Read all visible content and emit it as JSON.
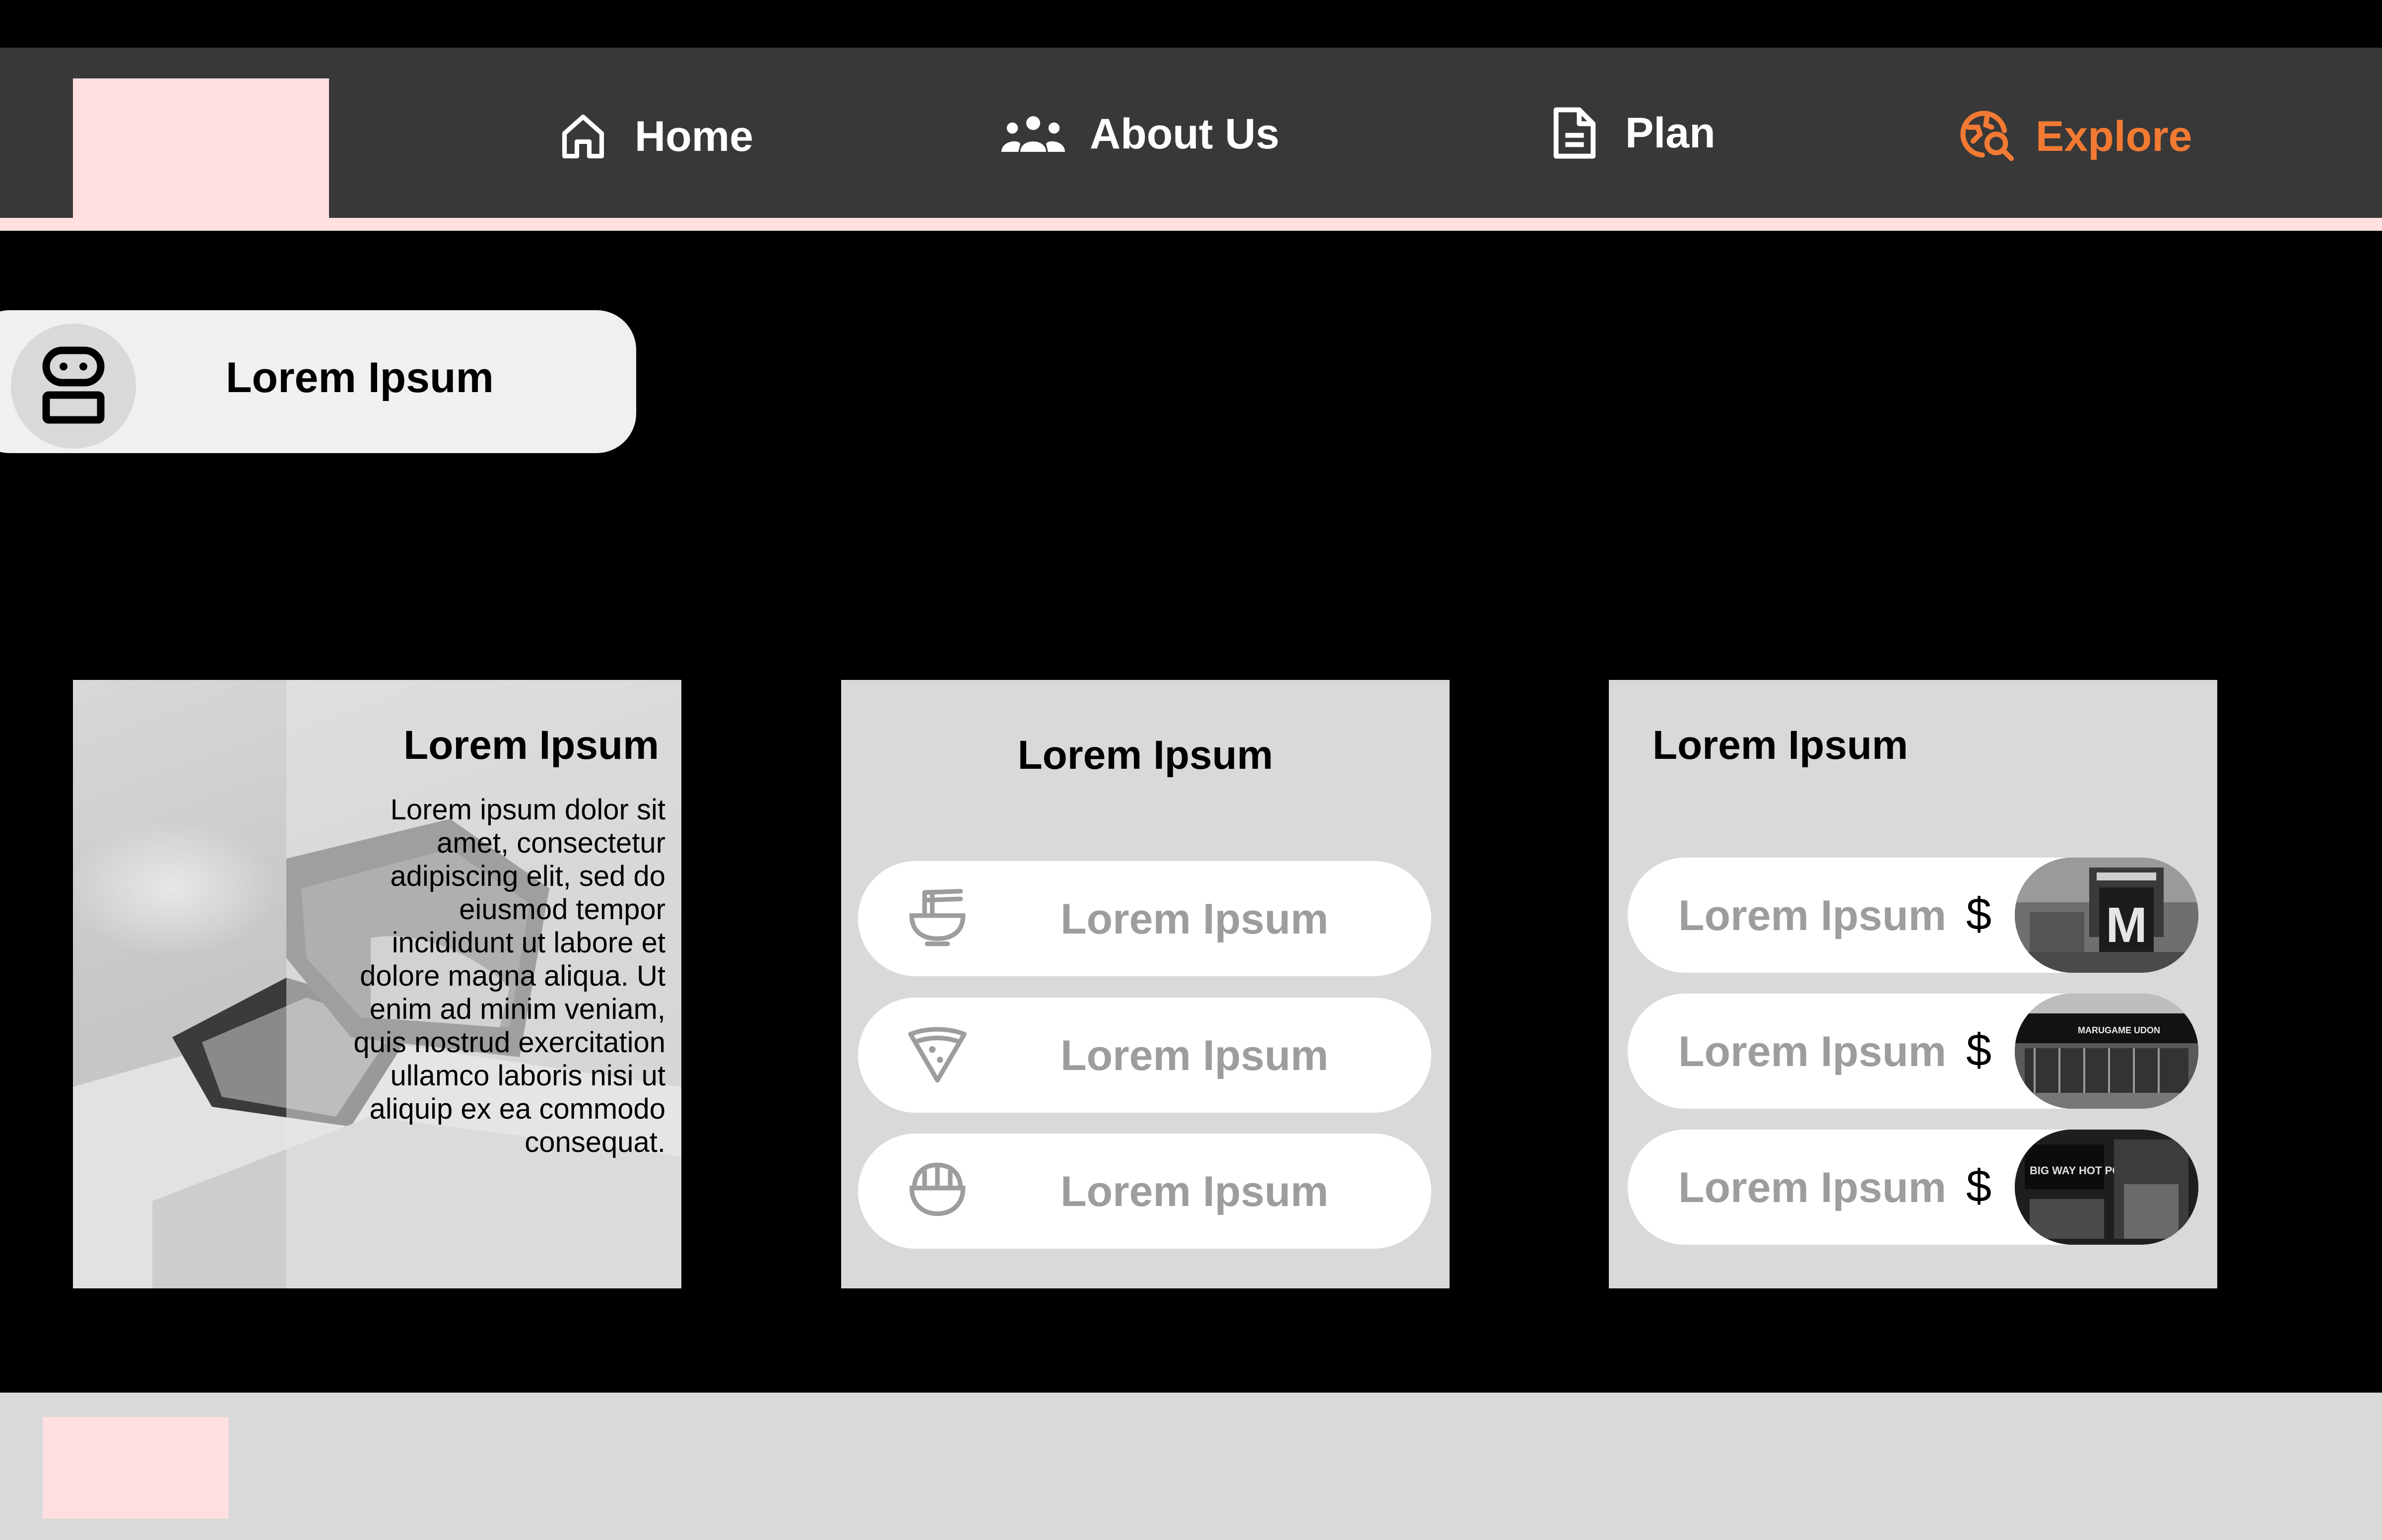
{
  "nav": {
    "items": [
      {
        "label": "Home",
        "icon": "home-icon"
      },
      {
        "label": "About Us",
        "icon": "users-icon"
      },
      {
        "label": "Plan",
        "icon": "document-icon"
      },
      {
        "label": "Explore",
        "icon": "explore-search-icon"
      }
    ],
    "active": "Explore",
    "active_color": "#f37a33",
    "underline_color": "#ffdfdf"
  },
  "chat": {
    "label": "Lorem Ipsum",
    "icon": "robot-icon"
  },
  "card1": {
    "title": "Lorem Ipsum",
    "body": "Lorem ipsum dolor sit amet, consectetur adipiscing elit, sed do eiusmod tempor incididunt ut labore et dolore magna aliqua. Ut enim ad minim veniam, quis nostrud exercitation ullamco laboris nisi ut aliquip ex ea commodo consequat."
  },
  "card2": {
    "title": "Lorem Ipsum",
    "options": [
      {
        "label": "Lorem Ipsum",
        "icon": "noodle-bowl-icon"
      },
      {
        "label": "Lorem Ipsum",
        "icon": "pizza-slice-icon"
      },
      {
        "label": "Lorem Ipsum",
        "icon": "rice-bowl-icon"
      }
    ]
  },
  "card3": {
    "title": "Lorem Ipsum",
    "restaurants": [
      {
        "label": "Lorem Ipsum",
        "price": "$",
        "photo": "mcdonalds-storefront-photo",
        "sign": "M"
      },
      {
        "label": "Lorem Ipsum",
        "price": "$",
        "photo": "marugame-udon-storefront-photo",
        "sign": "MARUGAME UDON"
      },
      {
        "label": "Lorem Ipsum",
        "price": "$",
        "photo": "big-way-hot-pot-storefront-photo",
        "sign": "BIG WAY HOT POT"
      }
    ]
  },
  "footer": {
    "logo_color": "#ffdfdf"
  }
}
